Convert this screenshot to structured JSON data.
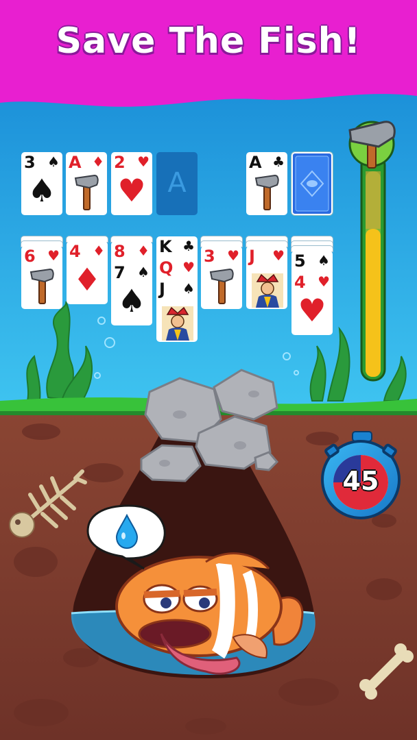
{
  "banner": {
    "title": "Save The Fish!"
  },
  "foundations": [
    {
      "rank": "3",
      "suit": "♠",
      "color": "#111111",
      "hammer": false
    },
    {
      "rank": "A",
      "suit": "♦",
      "color": "#e0202a",
      "hammer": true
    },
    {
      "rank": "2",
      "suit": "♥",
      "color": "#e0202a",
      "hammer": false
    },
    {
      "rank": "A",
      "placeholder": true
    }
  ],
  "waste": {
    "rank": "A",
    "suit": "♣",
    "color": "#111111",
    "hammer": true
  },
  "tableau": [
    {
      "cards": [
        {
          "rank": "6",
          "suit": "♥",
          "color": "#e0202a",
          "hammer": true
        }
      ]
    },
    {
      "cards": [
        {
          "rank": "4",
          "suit": "♦",
          "color": "#e0202a",
          "big": true
        }
      ]
    },
    {
      "cards": [
        {
          "rank": "8",
          "suit": "♦",
          "color": "#e0202a"
        },
        {
          "rank": "7",
          "suit": "♠",
          "color": "#111111",
          "big": true
        }
      ]
    },
    {
      "cards": [
        {
          "rank": "K",
          "suit": "♣",
          "color": "#111111"
        },
        {
          "rank": "Q",
          "suit": "♥",
          "color": "#e0202a"
        },
        {
          "rank": "J",
          "suit": "♠",
          "color": "#111111",
          "face": true
        }
      ]
    },
    {
      "cards": [
        {
          "rank": "3",
          "suit": "♥",
          "color": "#e0202a",
          "hammer": true
        }
      ]
    },
    {
      "cards": [
        {
          "rank": "J",
          "suit": "♥",
          "color": "#e0202a",
          "face": true
        }
      ]
    },
    {
      "cards": [
        {
          "rank": "5",
          "suit": "♠",
          "color": "#111111"
        },
        {
          "rank": "4",
          "suit": "♥",
          "color": "#e0202a",
          "big": true
        }
      ]
    }
  ],
  "hammer_meter": {
    "fill_level": 0.72,
    "icon": "hammer-icon"
  },
  "timer": {
    "value": "45"
  },
  "speech": {
    "icon": "water-drop-icon"
  },
  "colors": {
    "banner": "#e81fd0",
    "water": "#1aa0e0",
    "grass": "#2fb33a",
    "soil": "#7a3a2e",
    "accent": "#f5c21a"
  }
}
